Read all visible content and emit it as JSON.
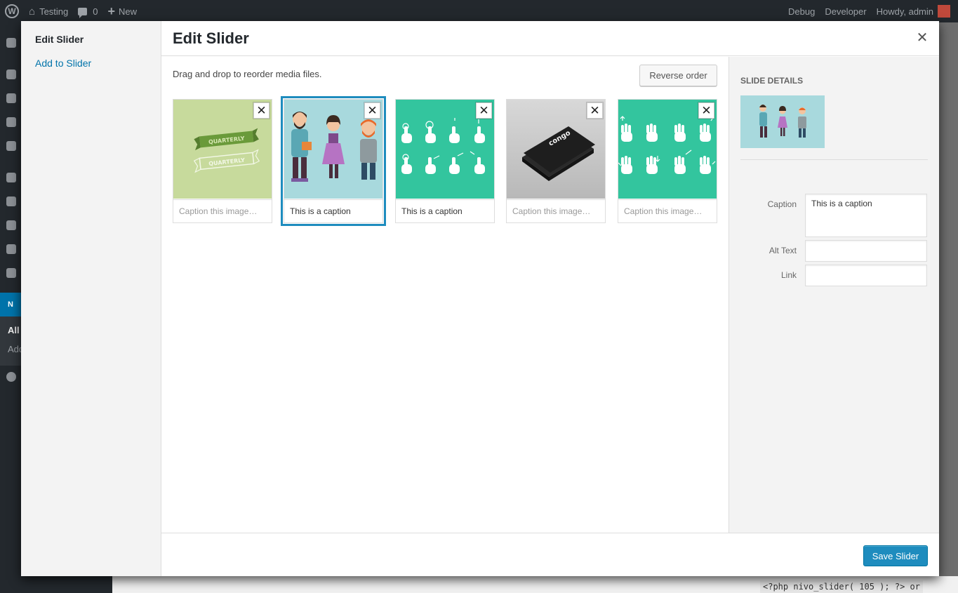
{
  "admin_bar": {
    "site_name": "Testing",
    "comments_count": "0",
    "new_label": "New",
    "debug_label": "Debug",
    "developer_label": "Developer",
    "howdy_label": "Howdy, admin"
  },
  "background": {
    "admin_menu_badge": "N",
    "submenu_all": "All",
    "submenu_add": "Add",
    "code_snippet": "<?php nivo_slider( 105 ); ?>  or"
  },
  "modal": {
    "menu": {
      "active_item": "Edit Slider",
      "add_item": "Add to Slider"
    },
    "title": "Edit Slider",
    "close_icon": "close-icon",
    "instructions": "Drag and drop to reorder media files.",
    "reverse_order_label": "Reverse order",
    "attachments": [
      {
        "thumb": "quarterly-banner",
        "caption": "",
        "placeholder": "Caption this image…",
        "selected": false
      },
      {
        "thumb": "three-characters",
        "caption": "This is a caption",
        "placeholder": "Caption this image…",
        "selected": true
      },
      {
        "thumb": "gesture-icons",
        "caption": "This is a caption",
        "placeholder": "Caption this image…",
        "selected": false
      },
      {
        "thumb": "congo-business-cards",
        "caption": "",
        "placeholder": "Caption this image…",
        "selected": false
      },
      {
        "thumb": "hand-gestures",
        "caption": "",
        "placeholder": "Caption this image…",
        "selected": false
      }
    ],
    "thumb_text": {
      "quarterly_1": "QUARTERLY",
      "quarterly_2": "QUARTERLY",
      "congo": "congo"
    },
    "slide_details": {
      "title": "Slide Details",
      "caption_label": "Caption",
      "caption_value": "This is a caption",
      "alt_label": "Alt Text",
      "alt_value": "",
      "link_label": "Link",
      "link_value": ""
    },
    "save_label": "Save Slider"
  },
  "colors": {
    "accent": "#1e8cbe",
    "link": "#0073aa",
    "thumb_green": "#c7da9c",
    "thumb_teal": "#33c59e",
    "thumb_light_blue": "#a8d9dd"
  }
}
